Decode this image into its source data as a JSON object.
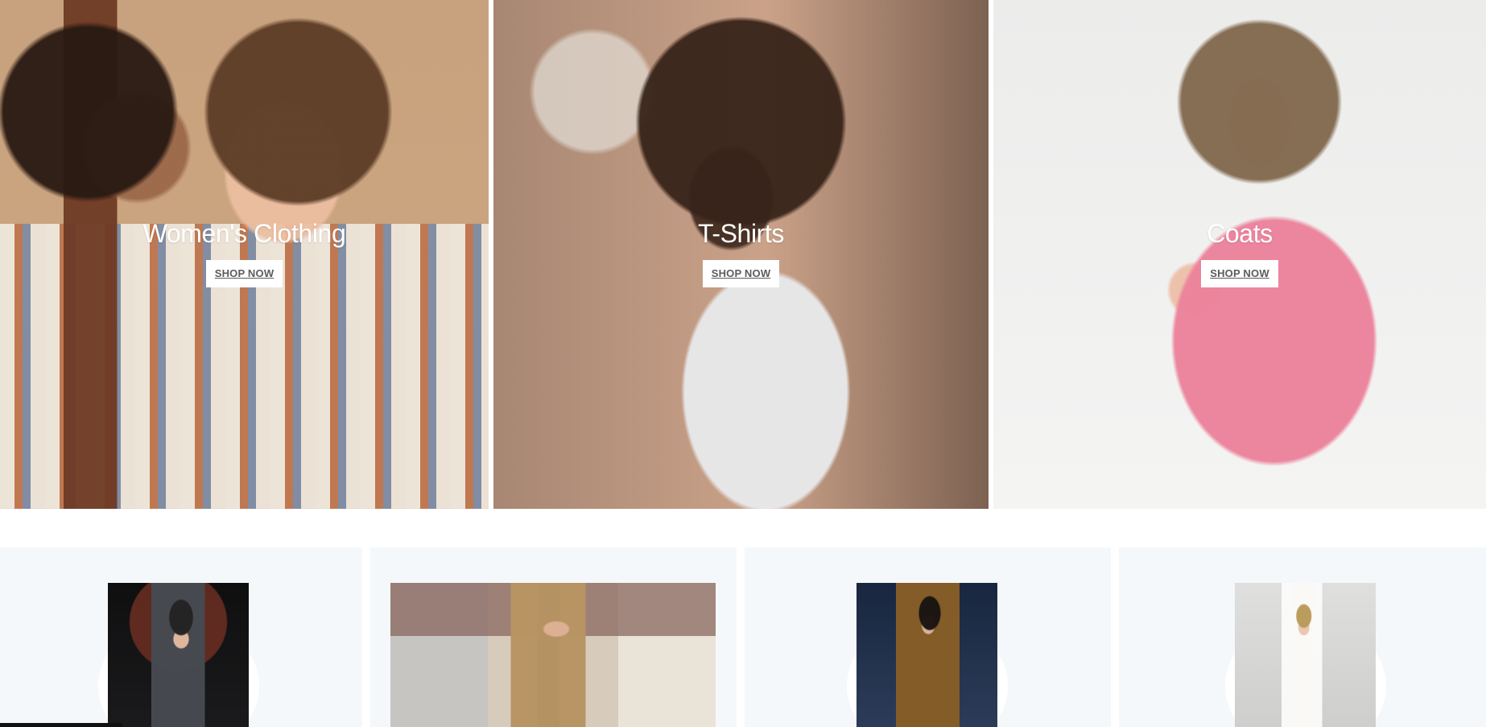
{
  "hero_cards": [
    {
      "title": "Women's Clothing",
      "button_label": "SHOP NOW",
      "image_subject": "two women portrait"
    },
    {
      "title": "T-Shirts",
      "button_label": "SHOP NOW",
      "image_subject": "woman with raised arm"
    },
    {
      "title": "Coats",
      "button_label": "SHOP NOW",
      "image_subject": "woman in pink jacket"
    }
  ],
  "product_cards": [
    {
      "image_subject": "man in grey coat"
    },
    {
      "image_subject": "man in camel coat"
    },
    {
      "image_subject": "woman in brown coat"
    },
    {
      "image_subject": "person in white tee and yellow pants"
    }
  ],
  "colors": {
    "hero_text": "#ffffff",
    "button_background": "#ffffff",
    "button_text": "#5b5b5b",
    "product_card_background": "#f4f8fb",
    "page_background": "#ffffff"
  },
  "icons": {
    "hero_images": "photo-icon",
    "product_images": "photo-icon"
  }
}
